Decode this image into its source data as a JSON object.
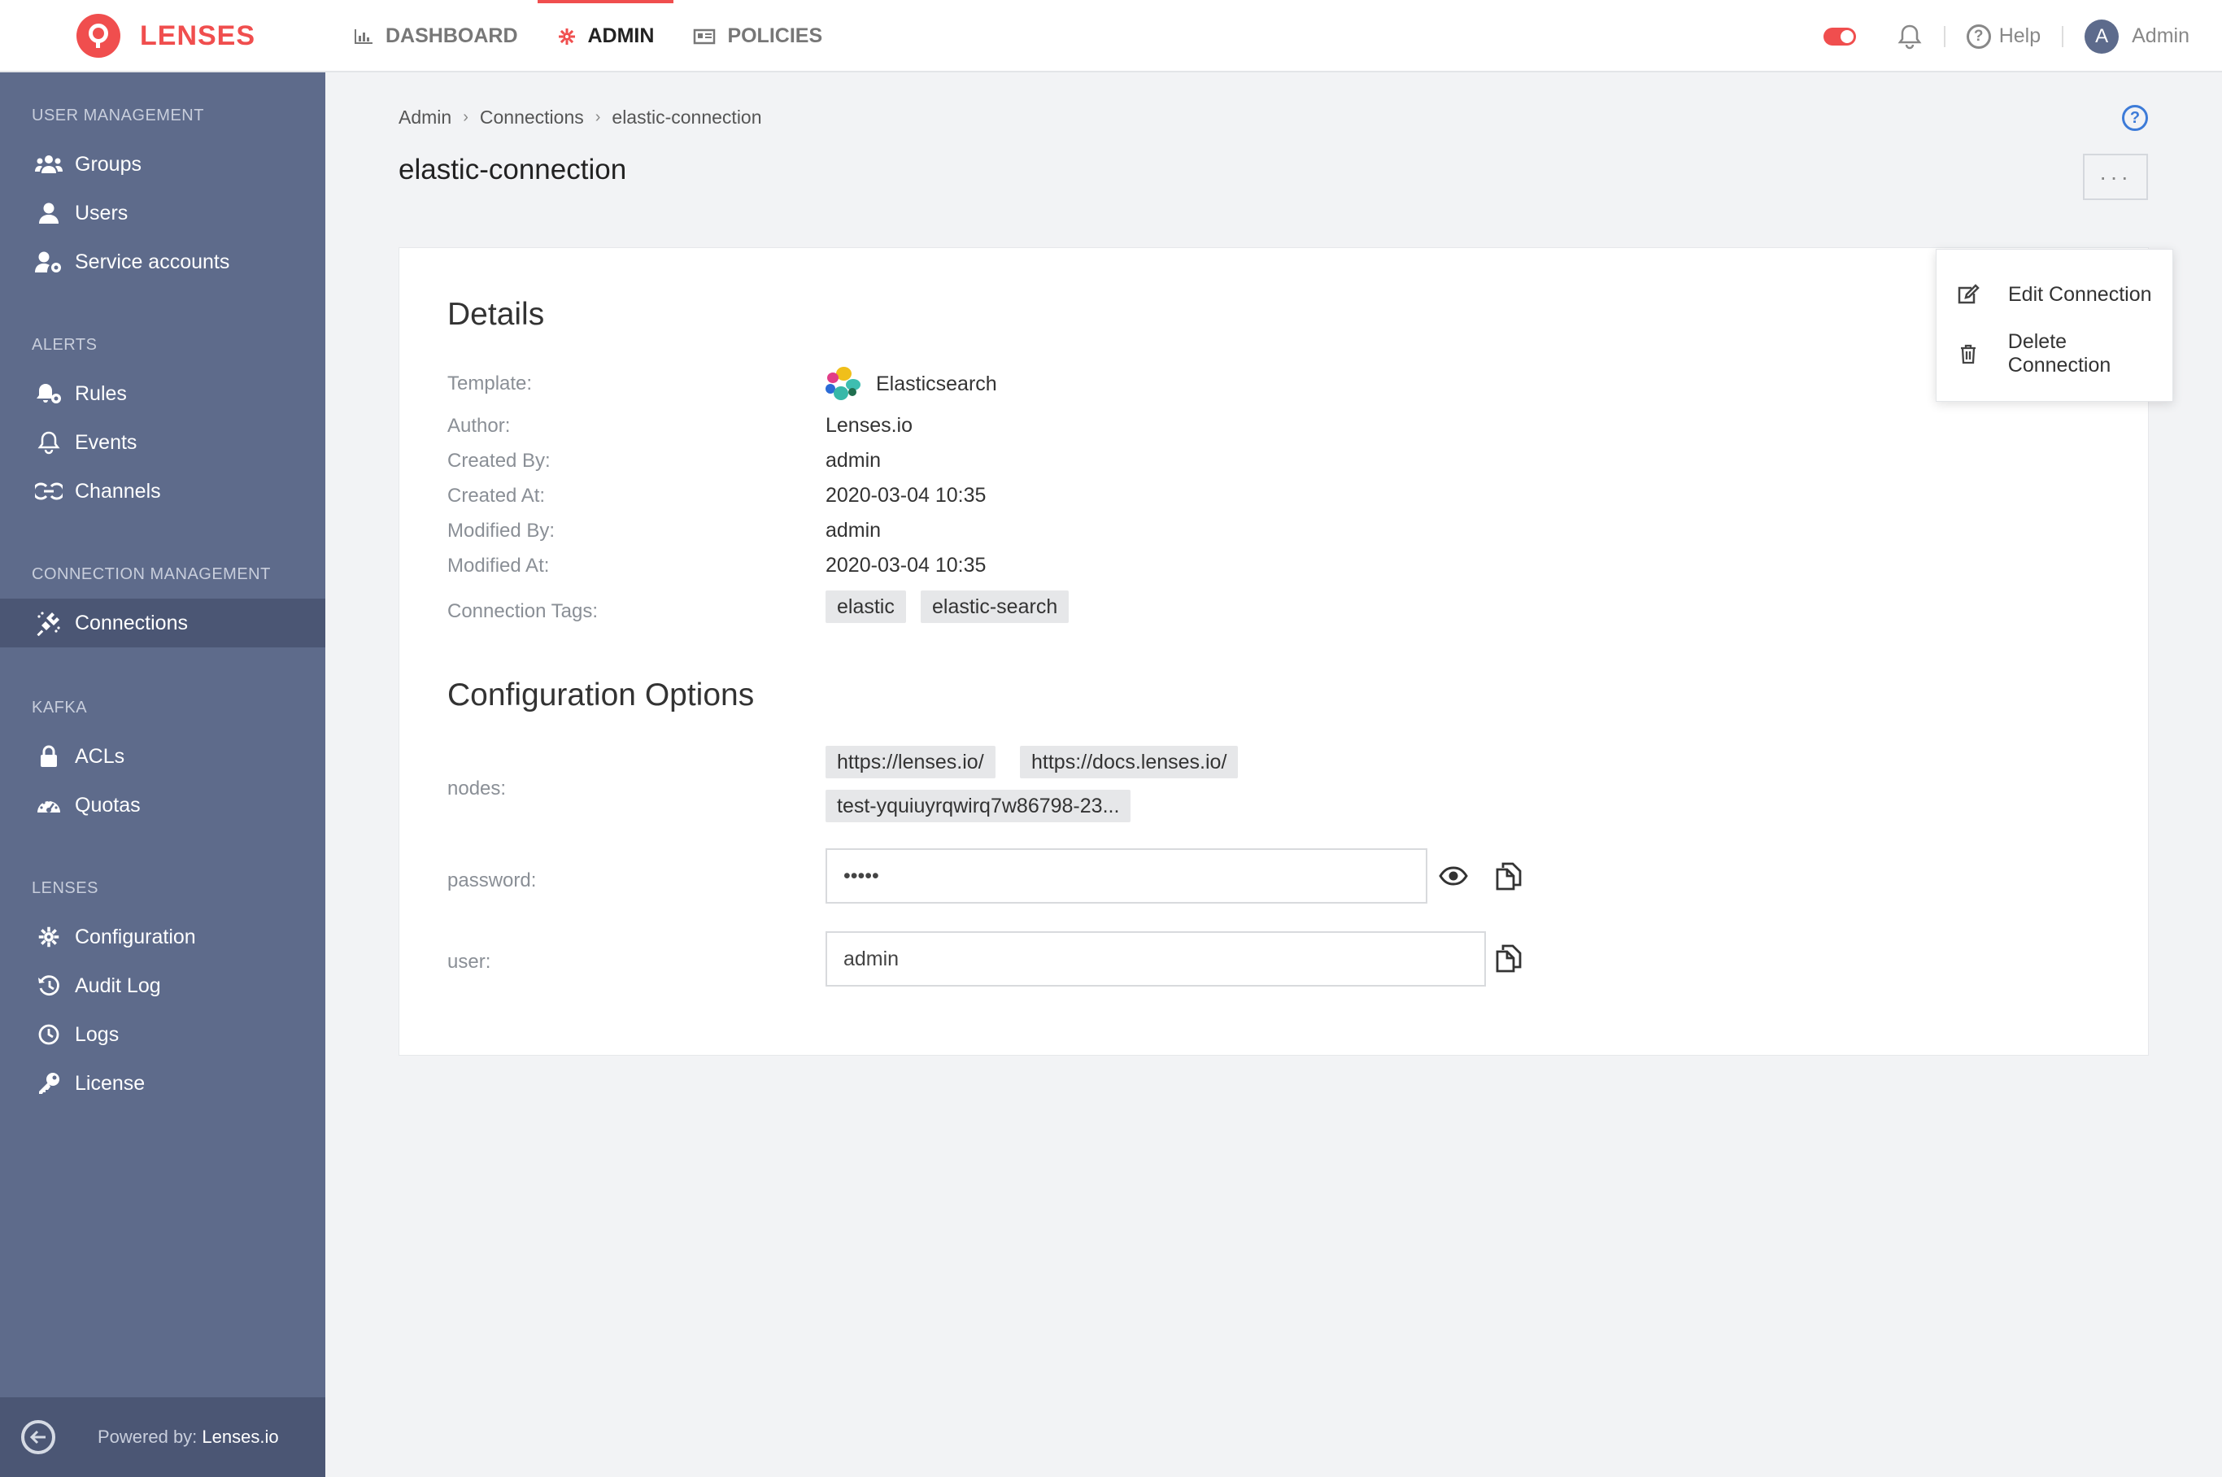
{
  "brand": {
    "name": "LENSES"
  },
  "nav": {
    "dashboard": "DASHBOARD",
    "admin": "ADMIN",
    "policies": "POLICIES"
  },
  "topbar": {
    "help": "Help",
    "user_initial": "A",
    "user_name": "Admin"
  },
  "sidebar": {
    "sections": {
      "user_management": "USER MANAGEMENT",
      "alerts": "ALERTS",
      "connection_management": "CONNECTION MANAGEMENT",
      "kafka": "KAFKA",
      "lenses": "LENSES"
    },
    "items": {
      "groups": "Groups",
      "users": "Users",
      "service_accounts": "Service accounts",
      "rules": "Rules",
      "events": "Events",
      "channels": "Channels",
      "connections": "Connections",
      "acls": "ACLs",
      "quotas": "Quotas",
      "configuration": "Configuration",
      "audit_log": "Audit Log",
      "logs": "Logs",
      "license": "License"
    },
    "footer": {
      "prefix": "Powered by:",
      "name": "Lenses.io"
    }
  },
  "breadcrumb": [
    "Admin",
    "Connections",
    "elastic-connection"
  ],
  "page": {
    "title": "elastic-connection",
    "more": "···"
  },
  "details": {
    "heading": "Details",
    "labels": {
      "template": "Template:",
      "author": "Author:",
      "created_by": "Created By:",
      "created_at": "Created At:",
      "modified_by": "Modified By:",
      "modified_at": "Modified At:",
      "tags": "Connection Tags:"
    },
    "values": {
      "template": "Elasticsearch",
      "author": "Lenses.io",
      "created_by": "admin",
      "created_at": "2020-03-04 10:35",
      "modified_by": "admin",
      "modified_at": "2020-03-04 10:35"
    },
    "tags": [
      "elastic",
      "elastic-search"
    ]
  },
  "config": {
    "heading": "Configuration Options",
    "labels": {
      "nodes": "nodes:",
      "password": "password:",
      "user": "user:"
    },
    "nodes": [
      "https://lenses.io/",
      "https://docs.lenses.io/",
      "test-yquiuyrqwirq7w86798-23..."
    ],
    "password": "•••••",
    "user": "admin"
  },
  "dropdown": {
    "edit": "Edit Connection",
    "delete": "Delete Connection"
  },
  "colors": {
    "brand": "#f04e4e",
    "sidebar": "#5e6b8b",
    "sidebar_active": "#4b5674",
    "link": "#3d7bd8"
  }
}
